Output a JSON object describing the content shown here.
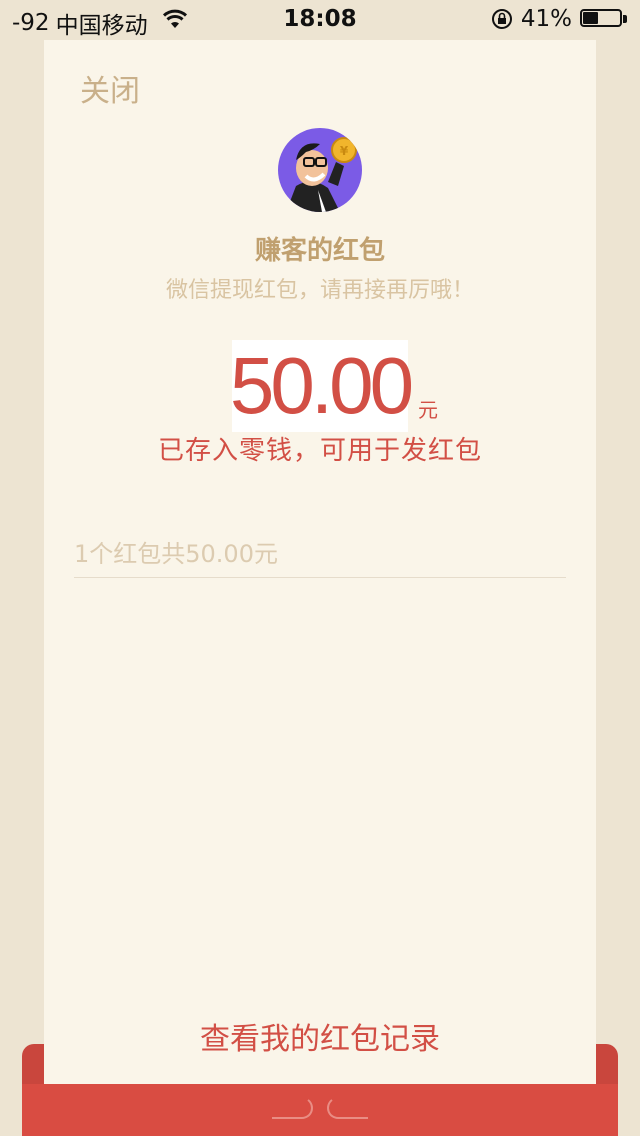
{
  "status_bar": {
    "signal": "-92",
    "carrier": "中国移动",
    "time": "18:08",
    "battery_percent_label": "41%",
    "battery_level": 0.41,
    "icons": [
      "wifi-icon",
      "rotation-lock-icon",
      "battery-icon"
    ]
  },
  "card": {
    "close_label": "关闭",
    "sender_name": "赚客的红包",
    "greeting": "微信提现红包，请再接再厉哦！",
    "amount": "50.00",
    "currency": "元",
    "saved_note": "已存入零钱，可用于发红包",
    "packet_summary": "1个红包共50.00元",
    "records_link": "查看我的红包记录"
  },
  "colors": {
    "background": "#ede4d2",
    "card": "#faf5e9",
    "accent_red": "#d24f45",
    "envelope_red": "#d94c42",
    "muted_gold": "#c0a06f"
  }
}
